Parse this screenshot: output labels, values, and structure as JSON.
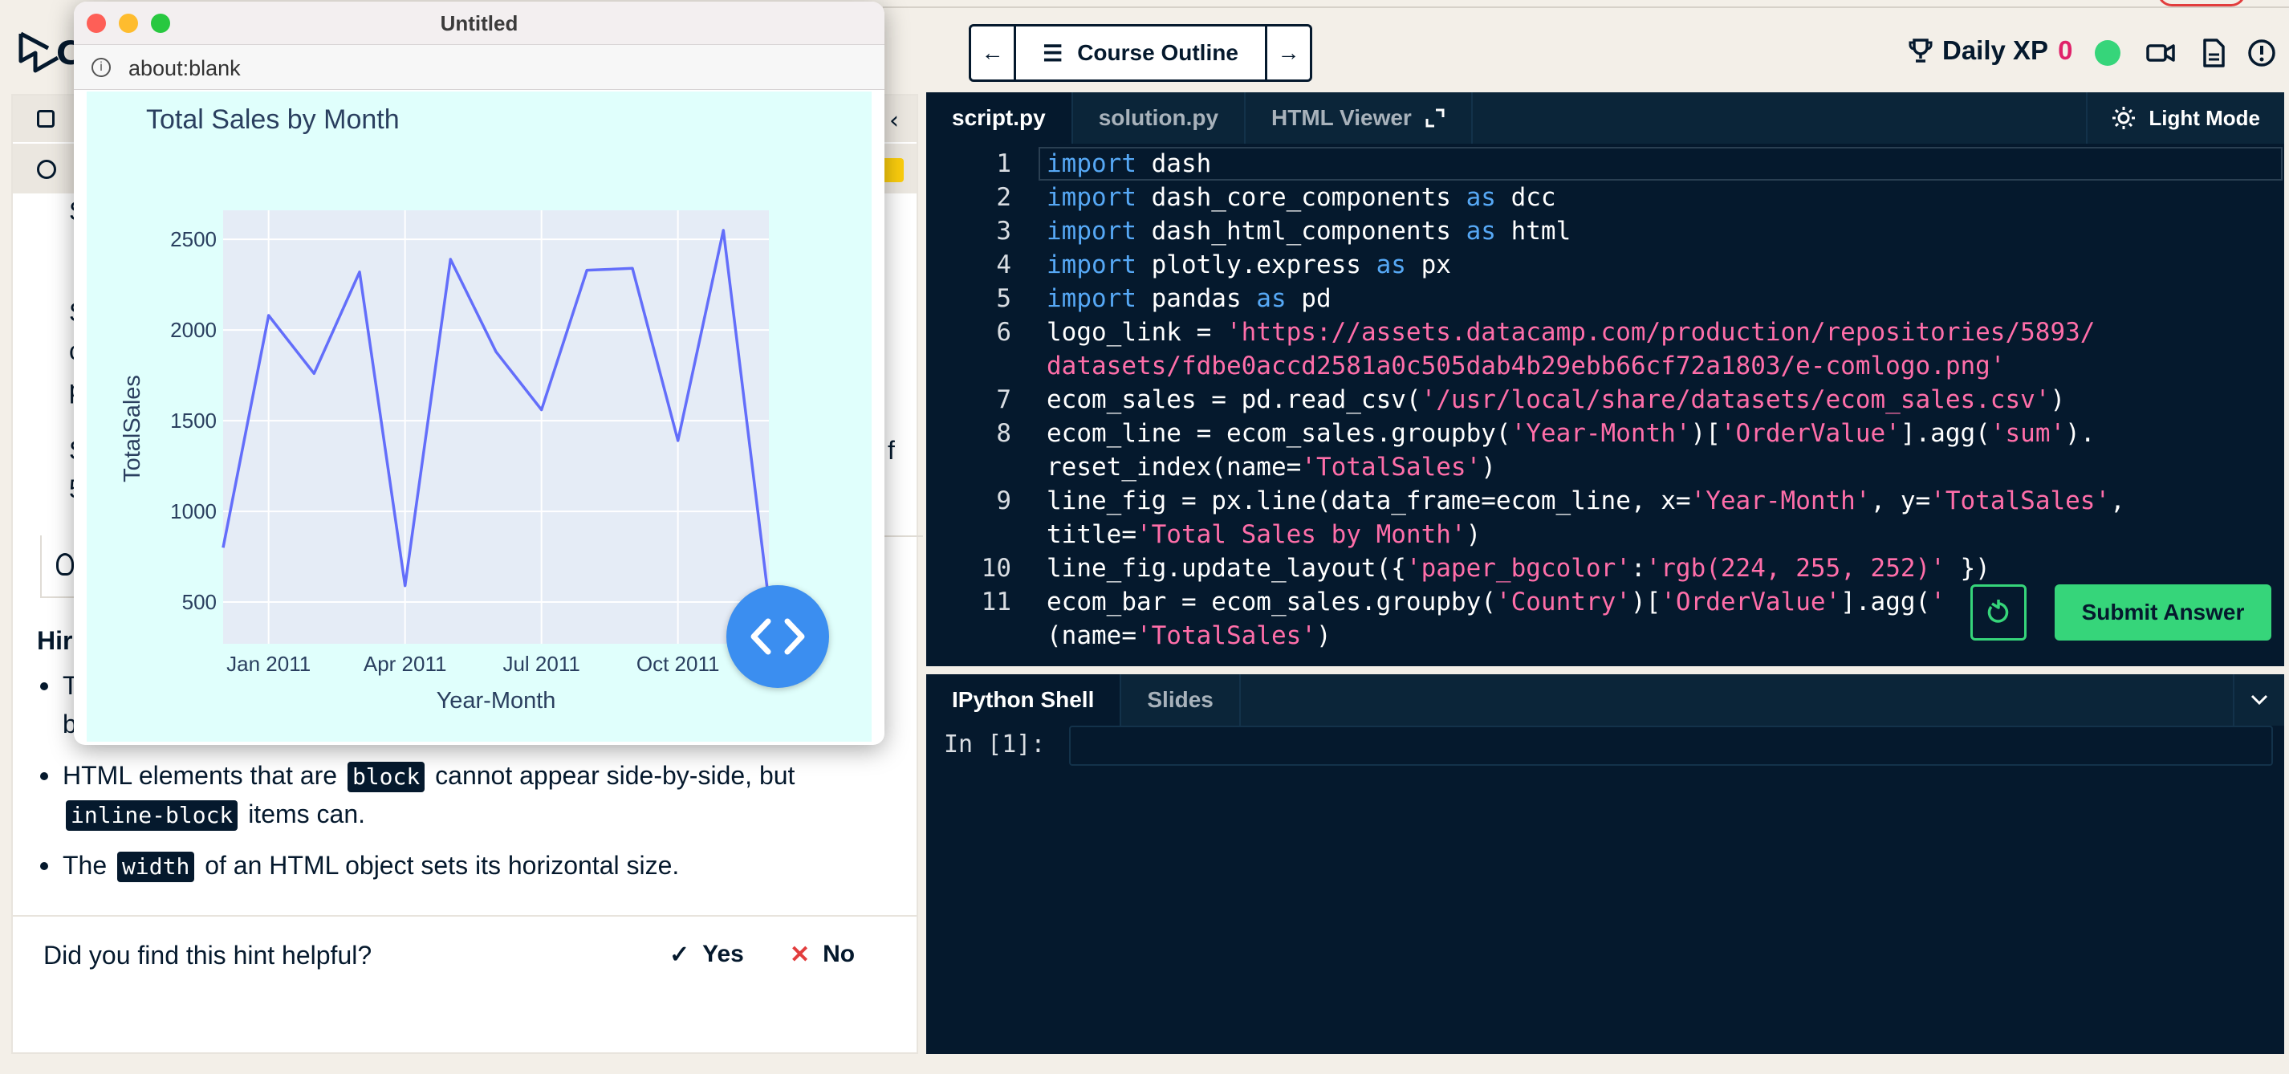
{
  "topbar": {
    "logo_letter": "C",
    "nav_prev": "←",
    "nav_next": "→",
    "course_outline": "Course Outline",
    "xp_label": "Daily XP",
    "xp_value": "0"
  },
  "left": {
    "fragments": [
      "S",
      "S",
      "c",
      "p",
      "S",
      "5",
      "f"
    ],
    "hint_title": "Hir",
    "hints": [
      {
        "parts": [
          "T",
          "b"
        ]
      },
      {
        "before": "HTML elements that are",
        "chip1": "block",
        "middle": "cannot appear side-by-side, but",
        "chip2": "inline-block",
        "after": "items can."
      },
      {
        "before": "The",
        "chip1": "width",
        "after": "of an HTML object sets its horizontal size."
      }
    ],
    "feedback_question": "Did you find this hint helpful?",
    "yes": "Yes",
    "no": "No"
  },
  "editor": {
    "tabs": [
      "script.py",
      "solution.py",
      "HTML Viewer"
    ],
    "light_mode": "Light Mode",
    "lines": [
      {
        "n": "1",
        "segs": [
          [
            "kw",
            "import"
          ],
          [
            "t",
            " dash"
          ]
        ]
      },
      {
        "n": "2",
        "segs": [
          [
            "kw",
            "import"
          ],
          [
            "t",
            " dash_core_components "
          ],
          [
            "kw",
            "as"
          ],
          [
            "t",
            " dcc"
          ]
        ]
      },
      {
        "n": "3",
        "segs": [
          [
            "kw",
            "import"
          ],
          [
            "t",
            " dash_html_components "
          ],
          [
            "kw",
            "as"
          ],
          [
            "t",
            " html"
          ]
        ]
      },
      {
        "n": "4",
        "segs": [
          [
            "kw",
            "import"
          ],
          [
            "t",
            " plotly.express "
          ],
          [
            "kw",
            "as"
          ],
          [
            "t",
            " px"
          ]
        ]
      },
      {
        "n": "5",
        "segs": [
          [
            "kw",
            "import"
          ],
          [
            "t",
            " pandas "
          ],
          [
            "kw",
            "as"
          ],
          [
            "t",
            " pd"
          ]
        ]
      },
      {
        "n": "6",
        "segs": [
          [
            "t",
            "logo_link = "
          ],
          [
            "st",
            "'https://assets.datacamp.com/production/repositories/5893/"
          ]
        ]
      },
      {
        "n": "",
        "segs": [
          [
            "st",
            "datasets/fdbe0accd2581a0c505dab4b29ebb66cf72a1803/e-comlogo.png'"
          ]
        ]
      },
      {
        "n": "7",
        "segs": [
          [
            "t",
            "ecom_sales = pd.read_csv("
          ],
          [
            "st",
            "'/usr/local/share/datasets/ecom_sales.csv'"
          ],
          [
            "t",
            ")"
          ]
        ]
      },
      {
        "n": "8",
        "segs": [
          [
            "t",
            "ecom_line = ecom_sales.groupby("
          ],
          [
            "st",
            "'Year-Month'"
          ],
          [
            "t",
            ")["
          ],
          [
            "st",
            "'OrderValue'"
          ],
          [
            "t",
            "].agg("
          ],
          [
            "st",
            "'sum'"
          ],
          [
            "t",
            ")."
          ]
        ]
      },
      {
        "n": "",
        "segs": [
          [
            "t",
            "reset_index(name="
          ],
          [
            "st",
            "'TotalSales'"
          ],
          [
            "t",
            ")"
          ]
        ]
      },
      {
        "n": "9",
        "segs": [
          [
            "t",
            "line_fig = px.line(data_frame=ecom_line, x="
          ],
          [
            "st",
            "'Year-Month'"
          ],
          [
            "t",
            ", y="
          ],
          [
            "st",
            "'TotalSales'"
          ],
          [
            "t",
            ","
          ]
        ]
      },
      {
        "n": "",
        "segs": [
          [
            "t",
            "title="
          ],
          [
            "st",
            "'Total Sales by Month'"
          ],
          [
            "t",
            ")"
          ]
        ]
      },
      {
        "n": "10",
        "segs": [
          [
            "t",
            "line_fig.update_layout({"
          ],
          [
            "st",
            "'paper_bgcolor'"
          ],
          [
            "t",
            ":"
          ],
          [
            "st",
            "'rgb(224, 255, 252)'"
          ],
          [
            "t",
            " })"
          ]
        ]
      },
      {
        "n": "11",
        "segs": [
          [
            "t",
            "ecom_bar = ecom_sales.groupby("
          ],
          [
            "st",
            "'Country'"
          ],
          [
            "t",
            ")["
          ],
          [
            "st",
            "'OrderValue'"
          ],
          [
            "t",
            "].agg("
          ],
          [
            "st",
            "'"
          ]
        ]
      },
      {
        "n": "",
        "segs": [
          [
            "t",
            "(name="
          ],
          [
            "st",
            "'TotalSales'"
          ],
          [
            "t",
            ")"
          ]
        ]
      }
    ],
    "submit": "Submit Answer"
  },
  "shell": {
    "tabs": [
      "IPython Shell",
      "Slides"
    ],
    "prompt": "In [1]:",
    "input_value": ""
  },
  "popup": {
    "title": "Untitled",
    "address": "about:blank"
  },
  "colors": {
    "accent_green": "#36d57a",
    "xp_pink": "#e0226a",
    "editor_bg": "#05192d",
    "chart_paper": "#e0fffc",
    "chart_plot": "#e5ecf6",
    "line_color": "#636efa"
  },
  "chart_data": {
    "type": "line",
    "title": "Total Sales by Month",
    "xlabel": "Year-Month",
    "ylabel": "TotalSales",
    "x_ticks": [
      "Jan 2011",
      "Apr 2011",
      "Jul 2011",
      "Oct 2011"
    ],
    "y_ticks": [
      500,
      1000,
      1500,
      2000,
      2500
    ],
    "ylim": [
      270,
      2660
    ],
    "x": [
      "2010-12",
      "2011-01",
      "2011-02",
      "2011-03",
      "2011-04",
      "2011-05",
      "2011-06",
      "2011-07",
      "2011-08",
      "2011-09",
      "2011-10",
      "2011-11",
      "2011-12"
    ],
    "values": [
      800,
      2080,
      1760,
      2320,
      590,
      2390,
      1880,
      1560,
      2330,
      2340,
      1390,
      2550,
      500
    ],
    "grid": true
  }
}
